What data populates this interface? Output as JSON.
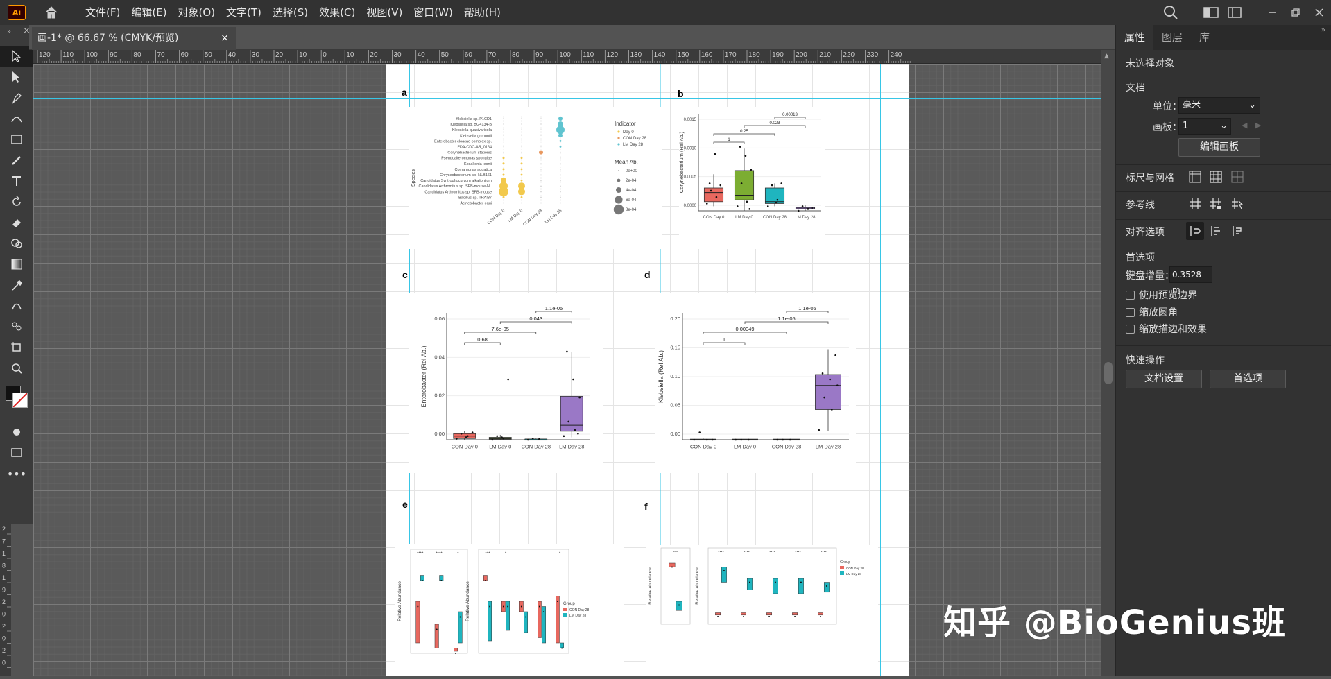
{
  "menubar": {
    "logo": "Ai",
    "menus": [
      "文件(F)",
      "编辑(E)",
      "对象(O)",
      "文字(T)",
      "选择(S)",
      "效果(C)",
      "视图(V)",
      "窗口(W)",
      "帮助(H)"
    ]
  },
  "document_tab": {
    "title": "画-1* @ 66.67 % (CMYK/预览)",
    "close": "×"
  },
  "ruler": {
    "labels": [
      "120",
      "110",
      "100",
      "90",
      "80",
      "70",
      "60",
      "50",
      "40",
      "30",
      "20",
      "10",
      "0",
      "10",
      "20",
      "30",
      "40",
      "50",
      "60",
      "70",
      "80",
      "90",
      "100",
      "110",
      "120",
      "130",
      "140",
      "150",
      "160",
      "170",
      "180",
      "190",
      "200",
      "210",
      "220",
      "230",
      "240"
    ]
  },
  "vertical_ruler": {
    "labels": [
      "2",
      "7",
      "1",
      "8",
      "1",
      "9",
      "2",
      "0",
      "2",
      "0",
      "2",
      "0"
    ]
  },
  "figure": {
    "panel_labels": [
      "a",
      "b",
      "c",
      "d",
      "e",
      "f"
    ],
    "panel_a": {
      "species": [
        "Klebsiella sp. P1CD1",
        "Klebsiella sp. BG4134-B",
        "Klebsiella quasivaricola",
        "Klebsiella grimontii",
        "Enterobacter cloacae complex sp.",
        "FDA-CDC-AR_0164",
        "Corynebacterium stationis",
        "Pseudoalteromonas spongiae",
        "Kosakonia jeonii",
        "Comamonas aquatica",
        "Chryseobacterium sp. NLB161",
        "Candidatus Syntrophocurvum alkaliphilum",
        "Candidatus Arthromitus sp. SFB-mouse-NL",
        "Candidatus Arthromitus sp. SFB-mouse",
        "Bacillus sp. TRAI37",
        "Acinetobacter equi"
      ],
      "xticks": [
        "CON Day 0",
        "LM Day 0",
        "CON Day 28",
        "LM Day 28"
      ],
      "ylabel": "Species",
      "legend_indicator_title": "Indicator",
      "legend_indicator": [
        "Day 0",
        "CON Day 28",
        "LM Day 28"
      ],
      "legend_size_title": "Mean Ab.",
      "legend_size": [
        "0e+00",
        "2e-04",
        "4e-04",
        "6e-04",
        "8e-04"
      ]
    },
    "panel_b": {
      "ylabel": "Corynebacterium (Rel Ab.)",
      "yticks": [
        "0.0015",
        "0.0010",
        "0.0005",
        "0.0000"
      ],
      "xticks": [
        "CON Day 0",
        "LM Day 0",
        "CON Day 28",
        "LM Day 28"
      ],
      "pvalues": [
        "0.00013",
        "0.023",
        "0.25",
        "1"
      ]
    },
    "panel_c": {
      "ylabel": "Enterobacter (Rel Ab.)",
      "yticks": [
        "0.06",
        "0.04",
        "0.02",
        "0.00"
      ],
      "xticks": [
        "CON Day 0",
        "LM Day 0",
        "CON Day 28",
        "LM Day 28"
      ],
      "pvalues": [
        "1.1e-05",
        "0.043",
        "7.6e-05",
        "0.68"
      ]
    },
    "panel_d": {
      "ylabel": "Klebsiella (Rel Ab.)",
      "yticks": [
        "0.20",
        "0.15",
        "0.10",
        "0.05",
        "0.00"
      ],
      "xticks": [
        "CON Day 0",
        "LM Day 0",
        "CON Day 28",
        "LM Day 28"
      ],
      "pvalues": [
        "1.1e-05",
        "1.1e-05",
        "0.00049",
        "1"
      ]
    },
    "panel_e": {
      "ylabel": "Relative Abundance",
      "sig": [
        "****",
        "****",
        "*",
        "***",
        "*",
        "*"
      ],
      "legend_title": "Group",
      "legend": [
        "CON Day 28",
        "LM Day 28"
      ]
    },
    "panel_f": {
      "ylabel": "Relative Abundance",
      "sig": [
        "***",
        "****",
        "****",
        "****",
        "****",
        "****"
      ],
      "legend_title": "Group",
      "legend": [
        "CON Day 28",
        "LM Day 28"
      ]
    }
  },
  "right_panel": {
    "tabs": [
      "属性",
      "图层",
      "库"
    ],
    "no_selection": "未选择对象",
    "document_title": "文档",
    "unit_label": "单位：",
    "unit_value": "毫米",
    "artboard_label": "画板：",
    "artboard_value": "1",
    "edit_artboard_button": "编辑画板",
    "rulers_grid_title": "标尺与网格",
    "guides_title": "参考线",
    "align_title": "对齐选项",
    "preferences_title": "首选项",
    "keyboard_increment_label": "键盘增量：",
    "keyboard_increment_value": "0.3528 m",
    "checkboxes": [
      "使用预览边界",
      "缩放圆角",
      "缩放描边和效果"
    ],
    "quick_actions_title": "快速操作",
    "doc_setup_button": "文档设置",
    "preferences_button": "首选项"
  },
  "watermark": "知乎 @BioGenius班",
  "colors": {
    "con": "#e8685f",
    "lm": "#7cad32",
    "con28": "#1fb5bf",
    "lm28": "#9a78c6",
    "guide": "#37c6e6",
    "accent": "#ff9a00"
  }
}
